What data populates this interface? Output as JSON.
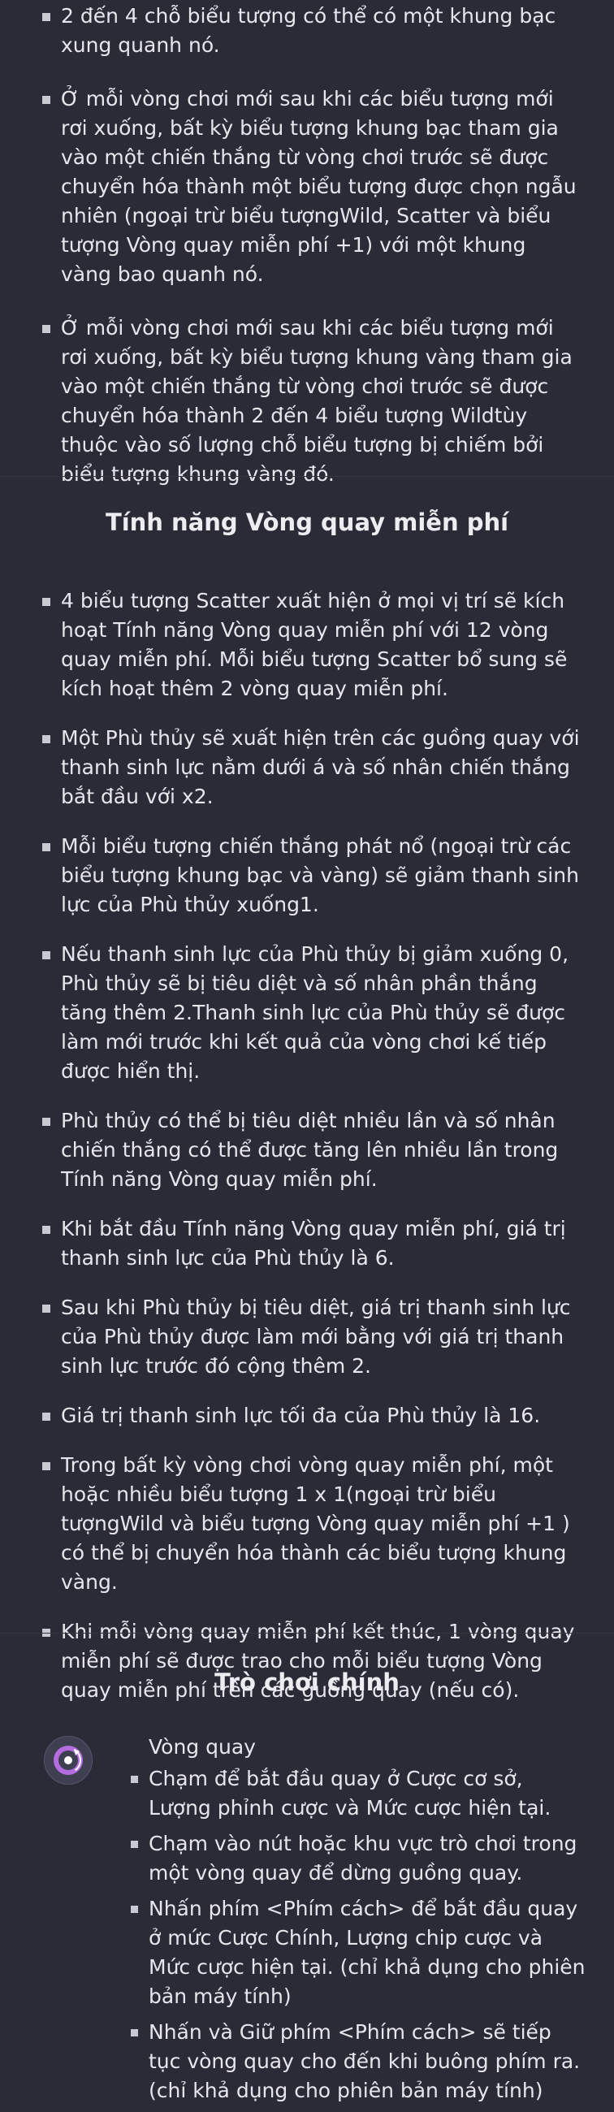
{
  "top_list": {
    "items": [
      "2 đến 4 chỗ biểu tượng có thể có một khung bạc xung quanh nó.",
      "Ở mỗi vòng chơi mới sau khi các biểu tượng mới rơi xuống, bất kỳ biểu tượng khung bạc tham gia vào một chiến thắng từ vòng chơi trước sẽ được chuyển hóa thành một biểu tượng được chọn ngẫu nhiên (ngoại trừ biểu tượngWild, Scatter và biểu tượng Vòng quay miễn phí +1) với một khung vàng bao quanh nó.",
      "Ở mỗi vòng chơi mới sau khi các biểu tượng mới rơi xuống, bất kỳ biểu tượng khung vàng tham gia vào một chiến thắng từ vòng chơi trước sẽ được chuyển hóa thành 2 đến 4 biểu tượng Wildtùy thuộc vào số lượng chỗ biểu tượng bị chiếm bởi biểu tượng khung vàng đó."
    ]
  },
  "free_spins": {
    "title": "Tính năng Vòng quay miễn phí",
    "items": [
      "4 biểu tượng Scatter xuất hiện ở mọi vị trí sẽ kích hoạt Tính năng Vòng quay miễn phí với 12 vòng quay miễn phí. Mỗi biểu tượng Scatter bổ sung sẽ kích hoạt thêm 2 vòng quay miễn phí.",
      "Một Phù thủy sẽ xuất hiện trên các guồng quay với thanh sinh lực nằm dưới á và số nhân chiến thắng bắt đầu với x2.",
      "Mỗi biểu tượng chiến thắng phát nổ (ngoại trừ các biểu tượng khung bạc và vàng) sẽ giảm thanh sinh lực của Phù thủy xuống1.",
      "Nếu thanh sinh lực của Phù thủy bị giảm xuống 0, Phù thủy sẽ bị tiêu diệt và số nhân phần thắng tăng thêm 2.Thanh sinh lực của Phù thủy sẽ được làm mới trước khi kết quả của vòng chơi kế tiếp được hiển thị.",
      "Phù thủy có thể bị tiêu diệt nhiều lần và số nhân chiến thắng có thể được tăng lên nhiều lần trong Tính năng Vòng quay miễn phí.",
      "Khi bắt đầu Tính năng Vòng quay miễn phí, giá trị thanh sinh lực của Phù thủy là 6.",
      "Sau khi Phù thủy bị tiêu diệt, giá trị thanh sinh lực của Phù thủy được làm mới bằng với giá trị thanh sinh lực trước đó cộng thêm 2.",
      "Giá trị thanh sinh lực tối đa của Phù thủy là 16.",
      "Trong bất kỳ vòng chơi vòng quay miễn phí, một hoặc nhiều biểu tượng 1 x 1(ngoại trừ biểu tượngWild và biểu tượng Vòng quay miễn phí +1 ) có thể bị chuyển hóa thành các biểu tượng khung vàng.",
      "Khi mỗi vòng quay miễn phí kết thúc, 1 vòng quay miễn phí sẽ được trao cho mỗi biểu tượng Vòng quay miễn phí trên các guồng quay (nếu có)."
    ]
  },
  "main_game": {
    "title": "Trò chơi chính",
    "icon": "spin-icon",
    "spin_heading": "Vòng quay",
    "items": [
      "Chạm để bắt đầu quay ở Cược cơ sở, Lượng phỉnh cược và Mức cược hiện tại.",
      "Chạm vào nút hoặc khu vực trò chơi trong một vòng quay để dừng guồng quay.",
      "Nhấn phím <Phím cách> để bắt đầu quay ở mức Cược Chính, Lượng chip cược và Mức cược hiện tại. (chỉ khả dụng cho phiên bản máy tính)",
      "Nhấn và Giữ phím <Phím cách> sẽ tiếp tục vòng quay cho đến khi buông phím ra. (chỉ khả dụng cho phiên bản máy tính)"
    ]
  },
  "colors": {
    "background": "#2a2b37",
    "text": "#e6e6ec",
    "icon_accent": "#b46ce0"
  }
}
